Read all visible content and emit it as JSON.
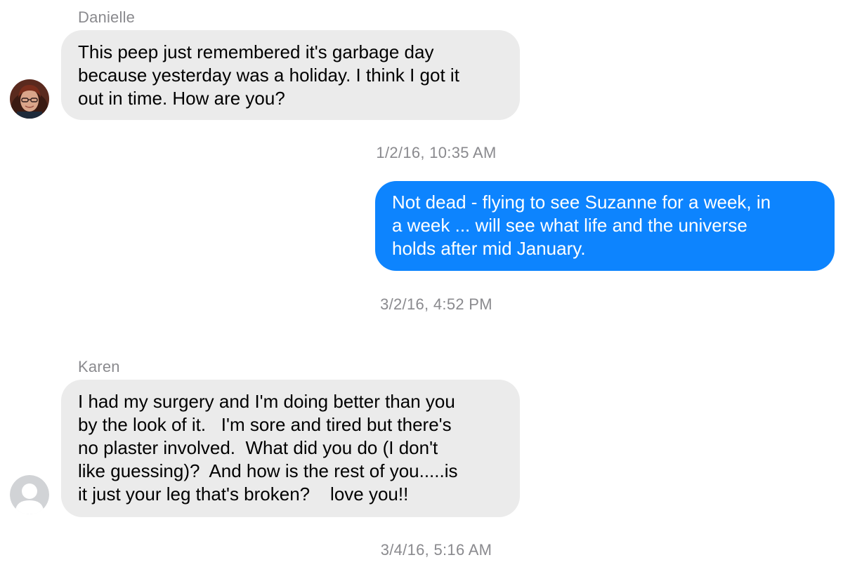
{
  "thread": {
    "messages": [
      {
        "sender": "Danielle",
        "direction": "incoming",
        "text": "This peep just remembered it's garbage day\nbecause yesterday was a holiday. I think I got it\nout in time. How are you?",
        "avatar": "photo"
      },
      {
        "direction": "outgoing",
        "text": "Not dead - flying to see Suzanne for a week, in\na week ... will see what life and the universe\nholds after mid January."
      },
      {
        "sender": "Karen",
        "direction": "incoming",
        "text": "I had my surgery and I'm doing better than you\nby the look of it.   I'm sore and tired but there's\nno plaster involved.  What did you do (I don't\nlike guessing)?  And how is the rest of you.....is\nit just your leg that's broken?    love you!!",
        "avatar": "placeholder"
      }
    ],
    "timestamps": [
      "1/2/16, 10:35 AM",
      "3/2/16, 4:52 PM",
      "3/4/16, 5:16 AM"
    ]
  },
  "colors": {
    "incoming_bubble": "#ebebeb",
    "outgoing_bubble": "#0d84fe",
    "meta_text": "#8a8a8e",
    "placeholder_avatar": "#d1d3d6"
  }
}
